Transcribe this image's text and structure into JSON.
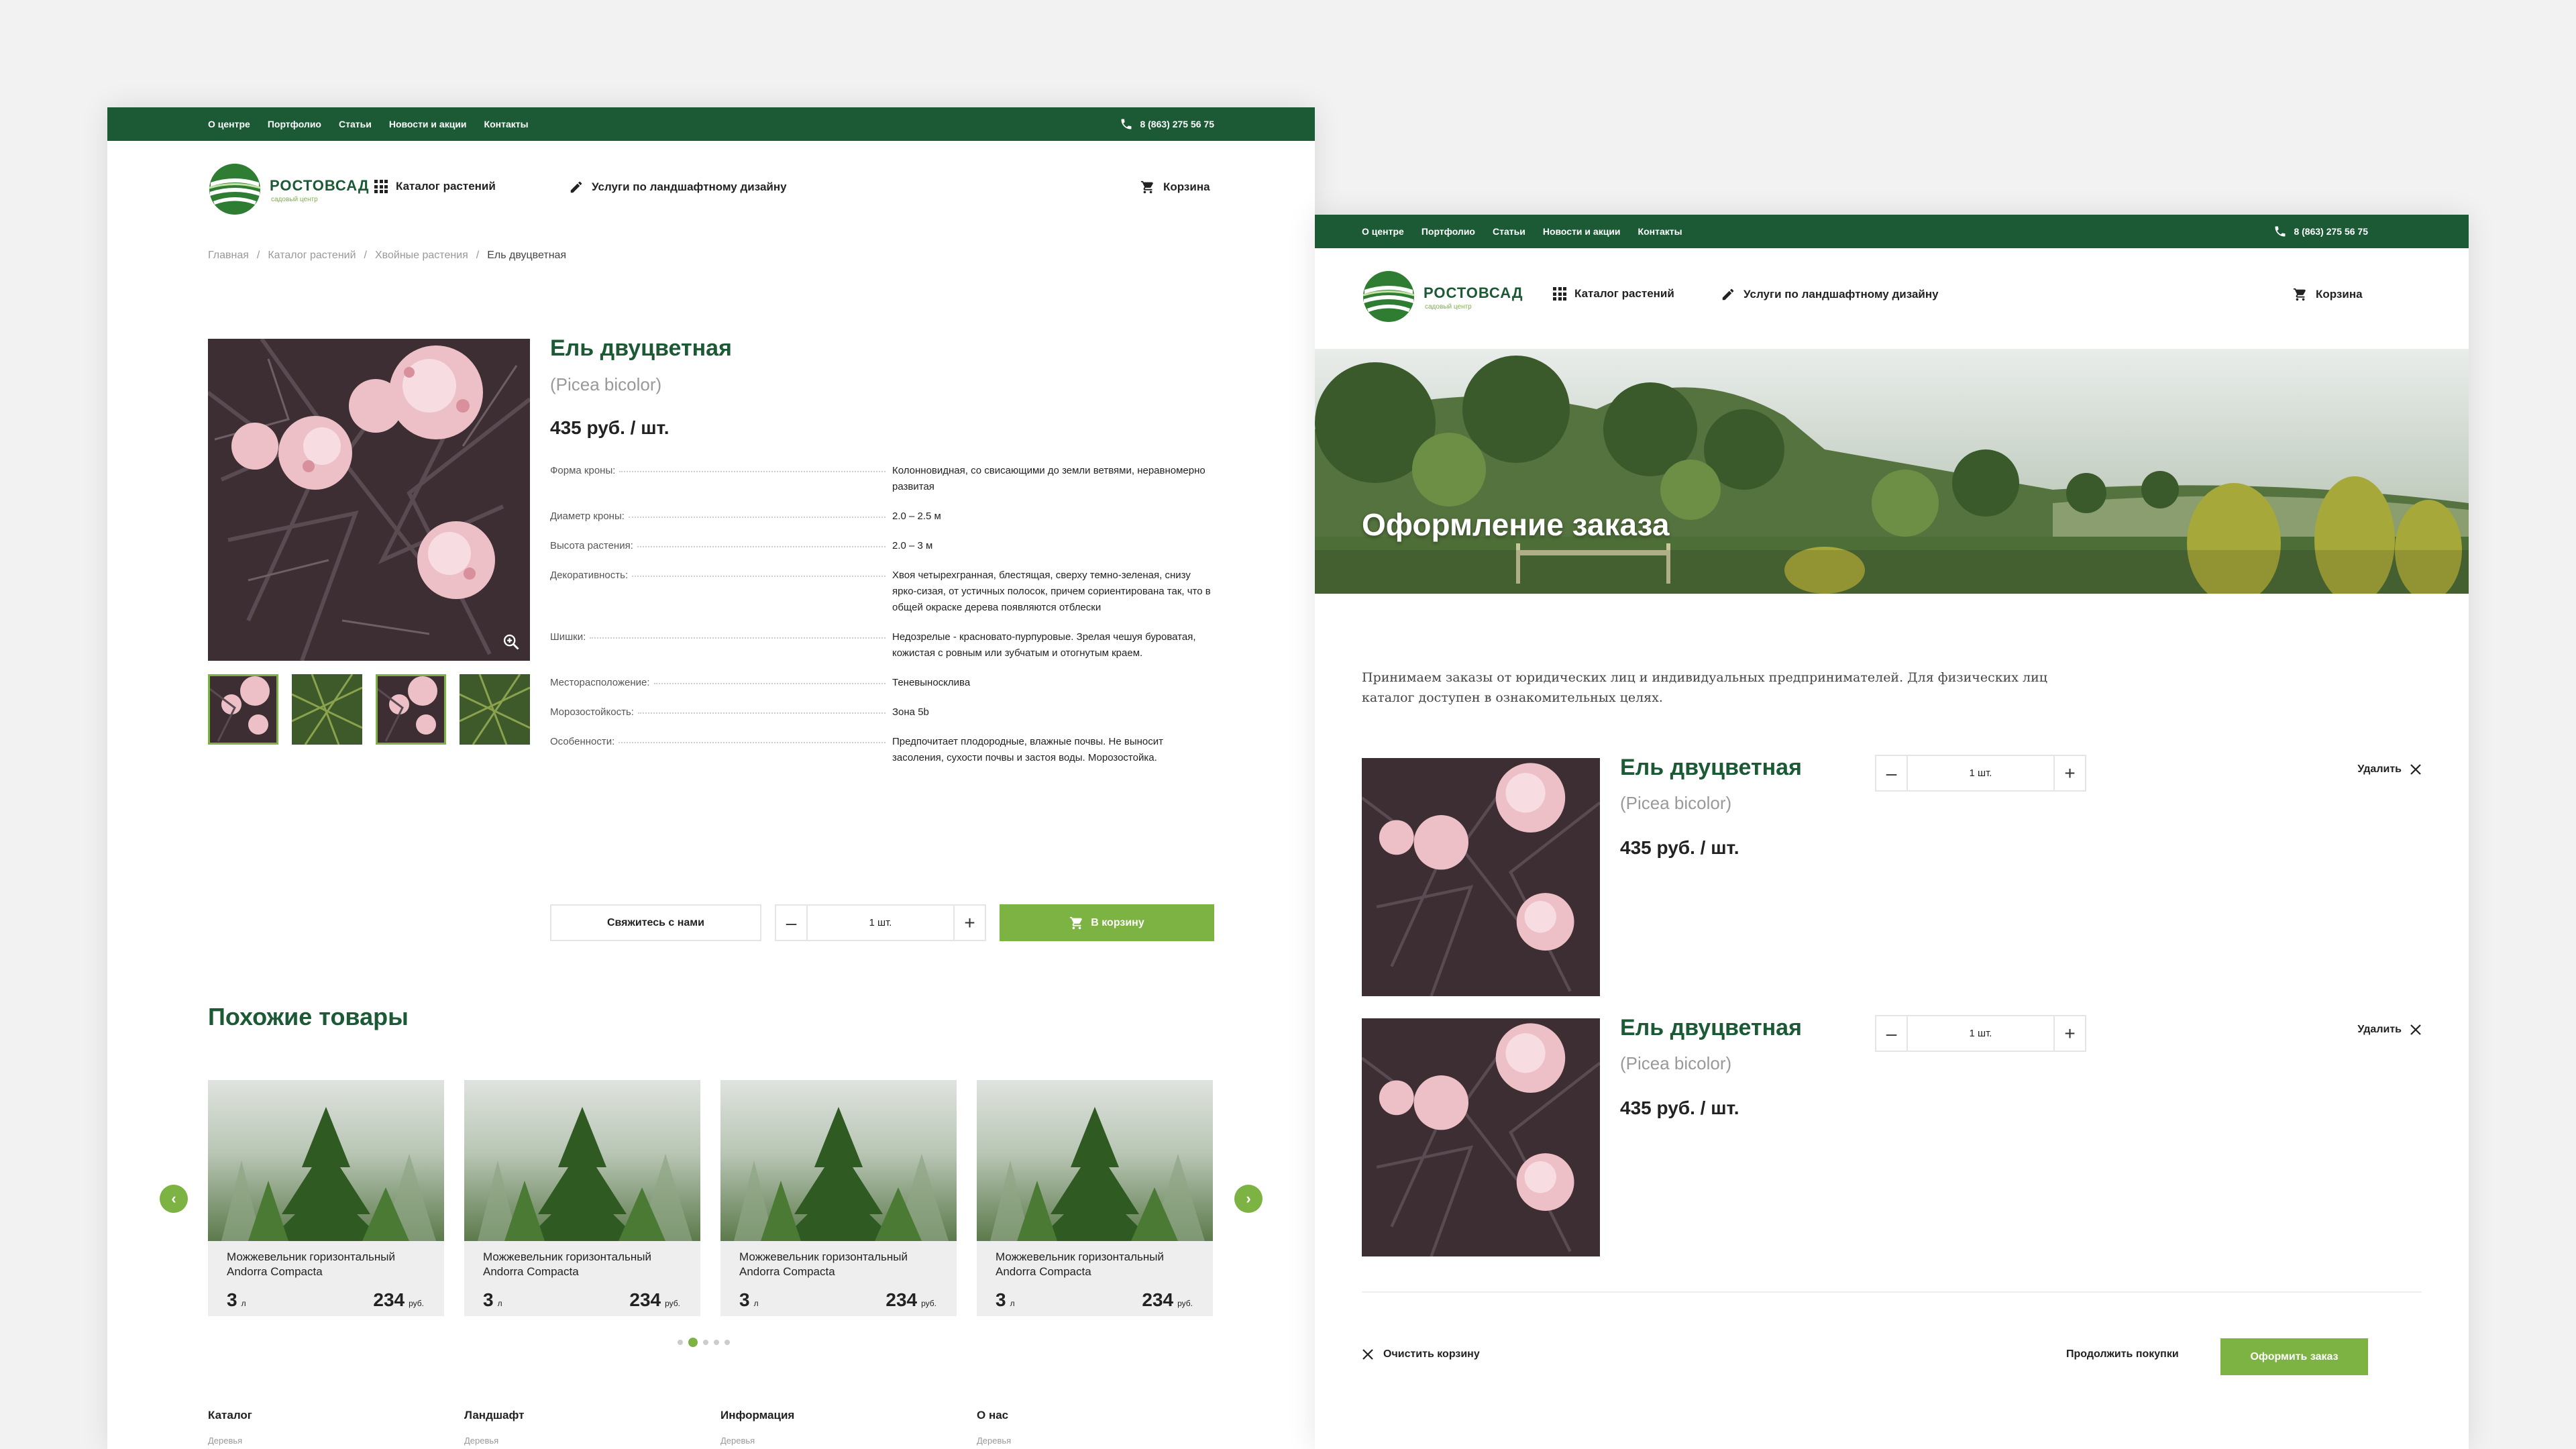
{
  "topbar": {
    "nav": [
      "О центре",
      "Портфолио",
      "Статьи",
      "Новости и акции",
      "Контакты"
    ],
    "phone": "8 (863) 275 56 75"
  },
  "header": {
    "logo_name": "РОСТОВСАД",
    "logo_sub": "садовый центр",
    "catalog": "Каталог растений",
    "services": "Услуги по ландшафтному дизайну",
    "cart": "Корзина"
  },
  "breadcrumb": [
    "Главная",
    "Каталог растений",
    "Хвойные растения",
    "Ель двуцветная"
  ],
  "product": {
    "title": "Ель двуцветная",
    "latin": "(Picea bicolor)",
    "price": "435 руб. / шт.",
    "specs": [
      {
        "label": "Форма кроны:",
        "value": "Колонновидная, со свисающими до земли ветвями, неравномерно развитая"
      },
      {
        "label": "Диаметр кроны:",
        "value": "2.0 – 2.5 м"
      },
      {
        "label": "Высота растения:",
        "value": "2.0 – 3 м"
      },
      {
        "label": "Декоративность:",
        "value": "Хвоя четырехгранная, блестящая, сверху темно-зеленая, снизу ярко-сизая, от устичных полосок, причем сориентирована так, что в общей окраске дерева появляются отблески"
      },
      {
        "label": "Шишки:",
        "value": "Недозрелые - красновато-пурпуровые. Зрелая чешуя буроватая, кожистая с ровным или зубчатым и отогнутым краем."
      },
      {
        "label": "Месторасположение:",
        "value": "Теневыносклива"
      },
      {
        "label": "Морозостойкость:",
        "value": "Зона 5b"
      },
      {
        "label": "Особенности:",
        "value": "Предпочитает плодородные, влажные почвы. Не выносит засоления, сухости почвы и застоя воды. Морозостойка."
      }
    ],
    "contact_btn": "Свяжитесь с нами",
    "qty": "1 шт.",
    "minus": "–",
    "plus": "+",
    "cart_btn": "В корзину"
  },
  "similar": {
    "title": "Похожие товары",
    "items": [
      {
        "name": "Можжевельник горизонтальный Andorra Compacta",
        "vol": "3",
        "vol_unit": "л",
        "price": "234",
        "price_unit": "руб."
      },
      {
        "name": "Можжевельник горизонтальный Andorra Compacta",
        "vol": "3",
        "vol_unit": "л",
        "price": "234",
        "price_unit": "руб."
      },
      {
        "name": "Можжевельник горизонтальный Andorra Compacta",
        "vol": "3",
        "vol_unit": "л",
        "price": "234",
        "price_unit": "руб."
      },
      {
        "name": "Можжевельник горизонтальный Andorra Compacta",
        "vol": "3",
        "vol_unit": "л",
        "price": "234",
        "price_unit": "руб."
      }
    ]
  },
  "footer": [
    {
      "title": "Каталог",
      "sub": "Деревья"
    },
    {
      "title": "Ландшафт",
      "sub": "Деревья"
    },
    {
      "title": "Информация",
      "sub": "Деревья"
    },
    {
      "title": "О нас",
      "sub": "Деревья"
    }
  ],
  "order": {
    "hero_title": "Оформление заказа",
    "notice": "Принимаем заказы от юридических лиц и индивидуальных предпринимателей. Для физических лиц каталог доступен в ознакомительных целях.",
    "items": [
      {
        "title": "Ель двуцветная",
        "latin": "(Picea bicolor)",
        "price": "435 руб. / шт.",
        "qty": "1 шт.",
        "delete": "Удалить"
      },
      {
        "title": "Ель двуцветная",
        "latin": "(Picea bicolor)",
        "price": "435 руб. / шт.",
        "qty": "1 шт.",
        "delete": "Удалить"
      }
    ],
    "clear": "Очистить корзину",
    "continue": "Продолжить покупки",
    "checkout": "Оформить заказ"
  },
  "colors": {
    "dark_green": "#1c5a36",
    "accent_green": "#7cb342"
  },
  "icons": [
    "phone-icon",
    "grid-icon",
    "pencil-icon",
    "cart-icon",
    "zoom-icon",
    "close-icon",
    "chevron-left-icon",
    "chevron-right-icon"
  ]
}
